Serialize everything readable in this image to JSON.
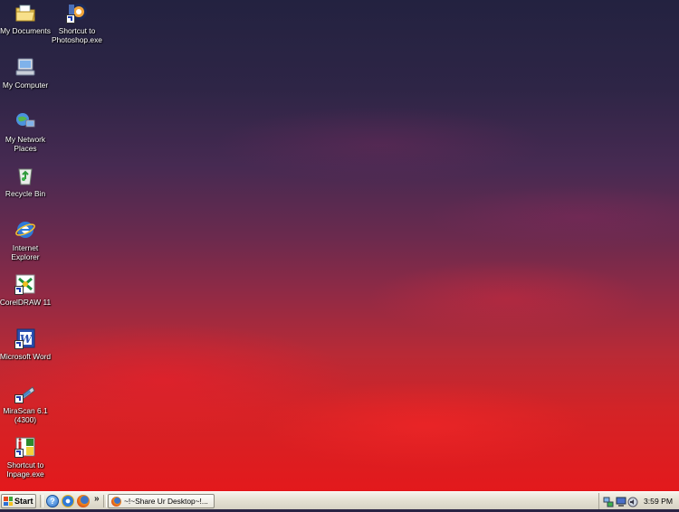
{
  "desktop": {
    "icons": [
      {
        "id": "my-documents",
        "label": "My Documents",
        "icon": "folder-documents-icon"
      },
      {
        "id": "photoshop",
        "label": "Shortcut to\nPhotoshop.exe",
        "icon": "photoshop-icon"
      },
      {
        "id": "my-computer",
        "label": "My Computer",
        "icon": "computer-icon"
      },
      {
        "id": "my-network-places",
        "label": "My Network\nPlaces",
        "icon": "network-icon"
      },
      {
        "id": "recycle-bin",
        "label": "Recycle Bin",
        "icon": "recycle-bin-icon"
      },
      {
        "id": "internet-explorer",
        "label": "Internet\nExplorer",
        "icon": "internet-explorer-icon"
      },
      {
        "id": "coreldraw",
        "label": "CorelDRAW 11",
        "icon": "coreldraw-icon"
      },
      {
        "id": "microsoft-word",
        "label": "Microsoft Word",
        "icon": "word-icon"
      },
      {
        "id": "mirascan",
        "label": "MiraScan 6.1\n(4300)",
        "icon": "scanner-icon"
      },
      {
        "id": "inpage",
        "label": "Shortcut to\nInpage.exe",
        "icon": "inpage-icon"
      }
    ]
  },
  "taskbar": {
    "start_label": "Start",
    "quick_launch": [
      "help-icon",
      "internet-explorer-icon",
      "firefox-icon"
    ],
    "chevron": "»",
    "task_button_label": "~!~Share Ur Desktop~!...",
    "tray_icons": [
      "network-tray-icon",
      "computer-tray-icon",
      "sound-tray-icon"
    ],
    "clock": "3:59 PM"
  }
}
